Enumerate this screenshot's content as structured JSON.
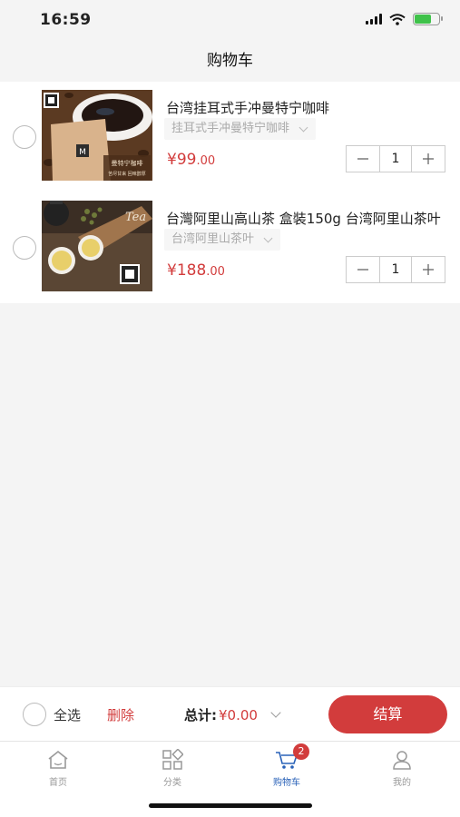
{
  "status": {
    "time": "16:59"
  },
  "nav": {
    "title": "购物车"
  },
  "cart": {
    "items": [
      {
        "name": "台湾挂耳式手冲曼特宁咖啡",
        "spec": "挂耳式手冲曼特宁咖啡",
        "currency": "¥",
        "price_int": "99",
        "price_dec": ".00",
        "qty": "1",
        "image_text": [
          "曼特宁咖啡",
          "苦尽甘来 回味醇厚"
        ]
      },
      {
        "name": "台灣阿里山高山茶 盒裝150g 台湾阿里山茶叶",
        "spec": "台湾阿里山茶叶",
        "currency": "¥",
        "price_int": "188",
        "price_dec": ".00",
        "qty": "1",
        "image_text": [
          "Tea"
        ]
      }
    ]
  },
  "footer": {
    "select_all": "全选",
    "delete": "删除",
    "total_label": "总计:",
    "total_amount": "¥0.00",
    "checkout": "结算"
  },
  "tabs": [
    {
      "label": "首页",
      "icon": "home-icon"
    },
    {
      "label": "分类",
      "icon": "category-icon"
    },
    {
      "label": "购物车",
      "icon": "cart-icon",
      "badge": "2",
      "active": true
    },
    {
      "label": "我的",
      "icon": "user-icon"
    }
  ],
  "colors": {
    "accent": "#d23c3c",
    "active_tab": "#2a62b8"
  }
}
